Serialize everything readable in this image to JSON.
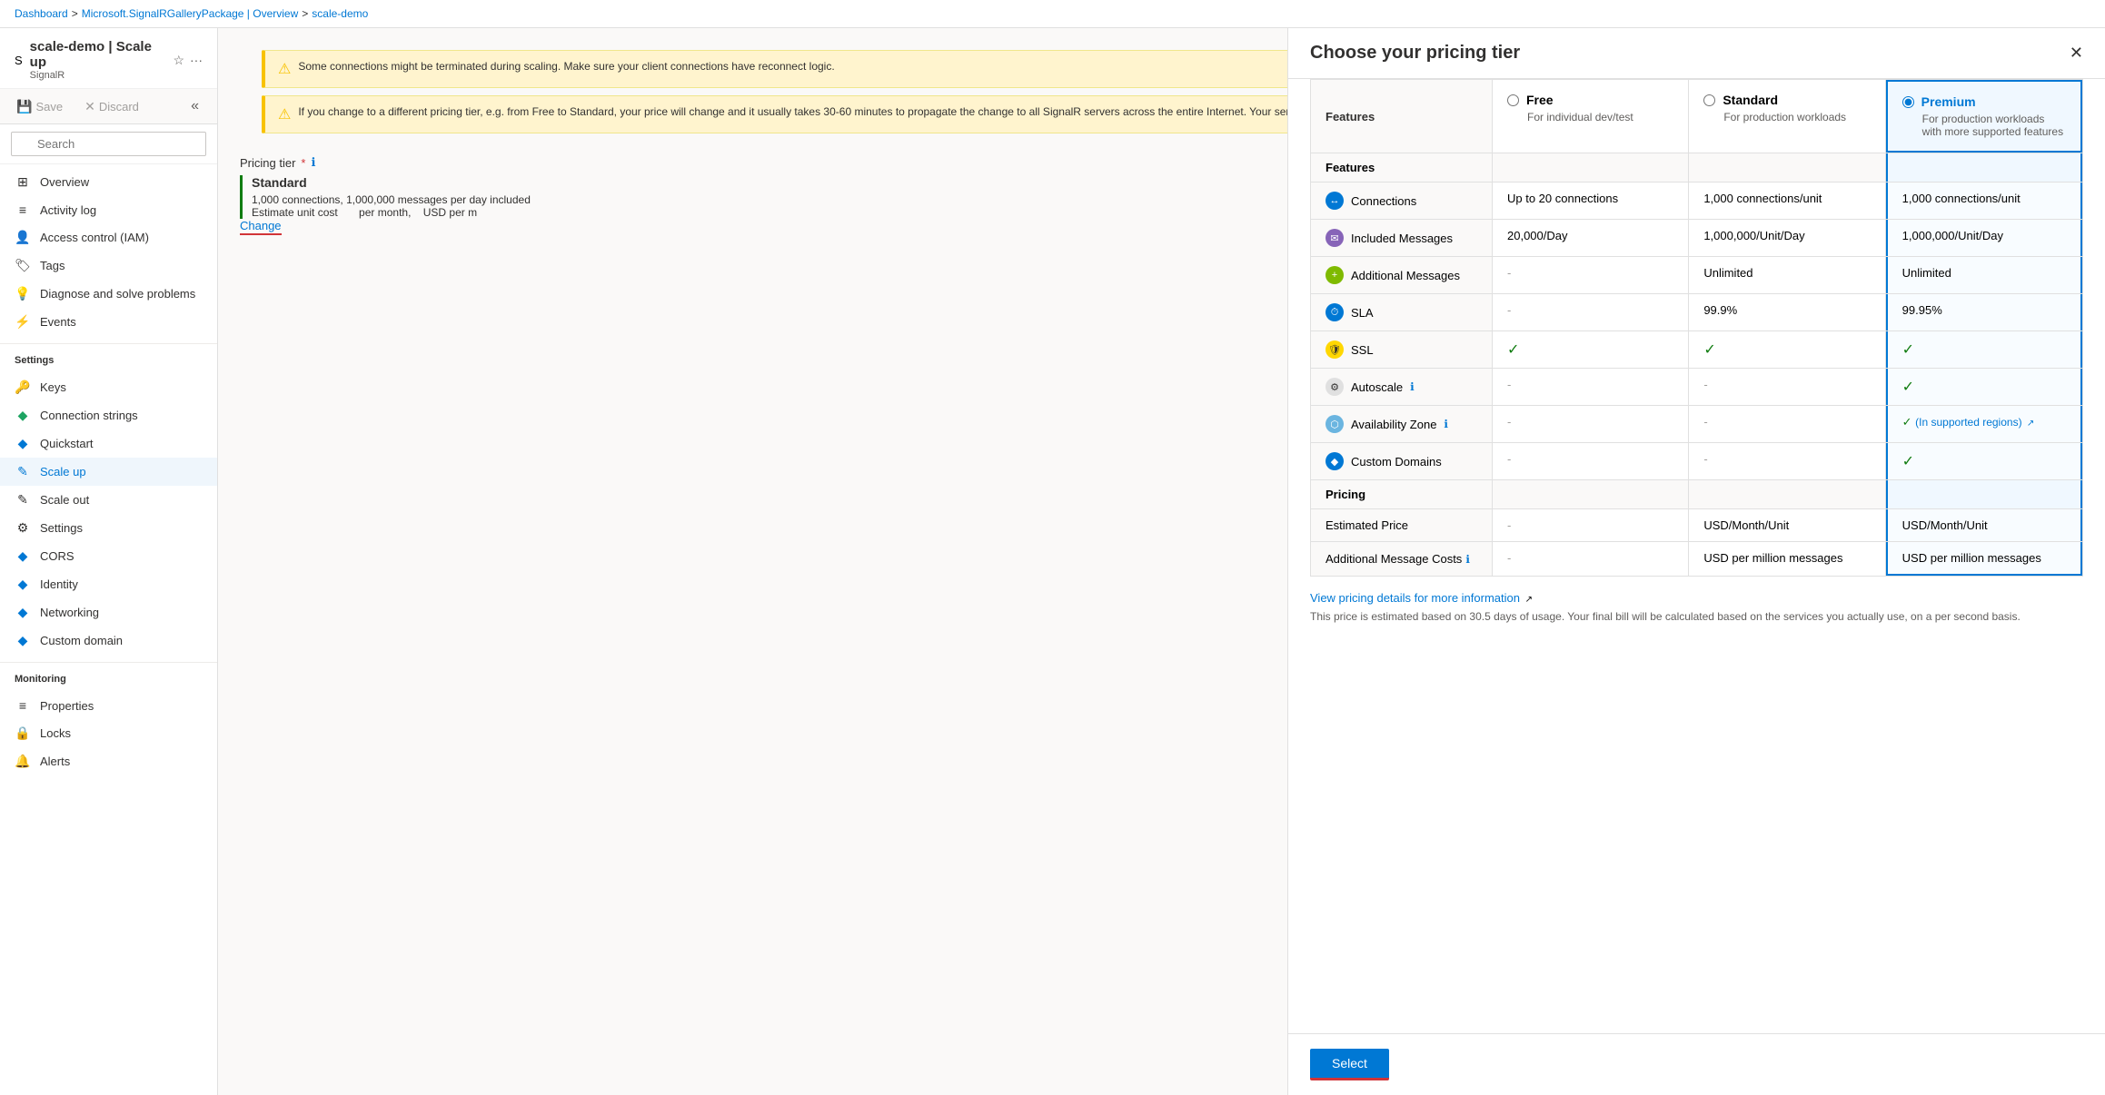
{
  "breadcrumb": {
    "items": [
      "Dashboard",
      "Microsoft.SignalRGalleryPackage | Overview",
      "scale-demo"
    ],
    "separators": [
      ">",
      ">"
    ]
  },
  "app": {
    "icon": "S",
    "title": "scale-demo | Scale up",
    "subtitle": "SignalR",
    "star_label": "☆",
    "more_label": "···"
  },
  "toolbar": {
    "save_label": "Save",
    "discard_label": "Discard",
    "collapse_label": "«"
  },
  "search": {
    "placeholder": "Search"
  },
  "nav": {
    "items": [
      {
        "id": "overview",
        "label": "Overview",
        "icon": "⊞"
      },
      {
        "id": "activity-log",
        "label": "Activity log",
        "icon": "≡"
      },
      {
        "id": "access-control",
        "label": "Access control (IAM)",
        "icon": "👤"
      },
      {
        "id": "tags",
        "label": "Tags",
        "icon": "🏷"
      },
      {
        "id": "diagnose",
        "label": "Diagnose and solve problems",
        "icon": "💡"
      },
      {
        "id": "events",
        "label": "Events",
        "icon": "⚡"
      }
    ],
    "settings_title": "Settings",
    "settings_items": [
      {
        "id": "keys",
        "label": "Keys",
        "icon": "🔑"
      },
      {
        "id": "connection-strings",
        "label": "Connection strings",
        "icon": "◆"
      },
      {
        "id": "quickstart",
        "label": "Quickstart",
        "icon": "◆"
      },
      {
        "id": "scale-up",
        "label": "Scale up",
        "icon": "✎",
        "active": true
      },
      {
        "id": "scale-out",
        "label": "Scale out",
        "icon": "✎"
      },
      {
        "id": "settings",
        "label": "Settings",
        "icon": "⚙"
      },
      {
        "id": "cors",
        "label": "CORS",
        "icon": "◆"
      },
      {
        "id": "identity",
        "label": "Identity",
        "icon": "◆"
      },
      {
        "id": "networking",
        "label": "Networking",
        "icon": "◆"
      },
      {
        "id": "custom-domain",
        "label": "Custom domain",
        "icon": "◆"
      }
    ],
    "monitoring_title": "Monitoring",
    "monitoring_items": [
      {
        "id": "properties",
        "label": "Properties",
        "icon": "≡"
      },
      {
        "id": "locks",
        "label": "Locks",
        "icon": "🔒"
      },
      {
        "id": "alerts",
        "label": "Alerts",
        "icon": "🔔"
      }
    ]
  },
  "main": {
    "warnings": [
      {
        "text": "Some connections might be terminated during scaling. Make sure your client connections have reconnect logic."
      },
      {
        "text": "If you change to a different pricing tier, e.g. from Free to Standard, your price will change and it usually takes 30-60 minutes to propagate the change to all SignalR servers across the entire Internet. Your service might be temporarily unavailable while it is updated. Generally, it's not recommended to change your pricing tier frequently."
      }
    ],
    "pricing_tier_label": "Pricing tier",
    "required_marker": "*",
    "current_tier": "Standard",
    "current_tier_desc": "1,000 connections, 1,000,000 messages per day included",
    "estimate_label": "Estimate unit cost",
    "estimate_suffix": "per month,",
    "estimate_currency": "USD per m",
    "change_link": "Change"
  },
  "panel": {
    "title": "Choose your pricing tier",
    "close_label": "✕",
    "tiers": [
      {
        "id": "free",
        "label": "Free",
        "desc": "For individual dev/test",
        "selected": false
      },
      {
        "id": "standard",
        "label": "Standard",
        "desc": "For production workloads",
        "selected": false
      },
      {
        "id": "premium",
        "label": "Premium",
        "desc": "For production workloads with more supported features",
        "selected": true
      }
    ],
    "features_label": "Features",
    "pricing_label": "Pricing",
    "features": [
      {
        "id": "connections",
        "label": "Connections",
        "icon_class": "icon-connections",
        "icon_text": "↔",
        "free": "Up to 20 connections",
        "standard": "1,000 connections/unit",
        "premium": "1,000 connections/unit"
      },
      {
        "id": "included-messages",
        "label": "Included Messages",
        "icon_class": "icon-messages",
        "icon_text": "✉",
        "free": "20,000/Day",
        "standard": "1,000,000/Unit/Day",
        "premium": "1,000,000/Unit/Day"
      },
      {
        "id": "additional-messages",
        "label": "Additional Messages",
        "icon_class": "icon-add-msg",
        "icon_text": "+",
        "free": "-",
        "standard": "Unlimited",
        "premium": "Unlimited"
      },
      {
        "id": "sla",
        "label": "SLA",
        "icon_class": "icon-sla",
        "icon_text": "⏱",
        "free": "-",
        "standard": "99.9%",
        "premium": "99.95%"
      },
      {
        "id": "ssl",
        "label": "SSL",
        "icon_class": "icon-ssl",
        "icon_text": "🔒",
        "free": "check",
        "standard": "check",
        "premium": "check"
      },
      {
        "id": "autoscale",
        "label": "Autoscale",
        "icon_class": "icon-autoscale",
        "icon_text": "⚙",
        "free": "-",
        "standard": "-",
        "premium": "check"
      },
      {
        "id": "availability-zone",
        "label": "Availability Zone",
        "icon_class": "icon-avail",
        "icon_text": "⬡",
        "free": "-",
        "standard": "-",
        "premium_special": "(In supported regions) ↗",
        "premium": "special"
      },
      {
        "id": "custom-domains",
        "label": "Custom Domains",
        "icon_class": "icon-domains",
        "icon_text": "◆",
        "free": "-",
        "standard": "-",
        "premium": "check"
      }
    ],
    "pricing_rows": [
      {
        "id": "estimated-price",
        "label": "Estimated Price",
        "free": "-",
        "standard": "USD/Month/Unit",
        "premium": "USD/Month/Unit"
      },
      {
        "id": "additional-message-costs",
        "label": "Additional Message Costs",
        "free": "-",
        "standard": "USD per million messages",
        "premium": "USD per million messages"
      }
    ],
    "view_pricing_link": "View pricing details for more information",
    "pricing_note": "This price is estimated based on 30.5 days of usage. Your final bill will be calculated based on the services you actually use, on a per second basis.",
    "select_label": "Select"
  }
}
